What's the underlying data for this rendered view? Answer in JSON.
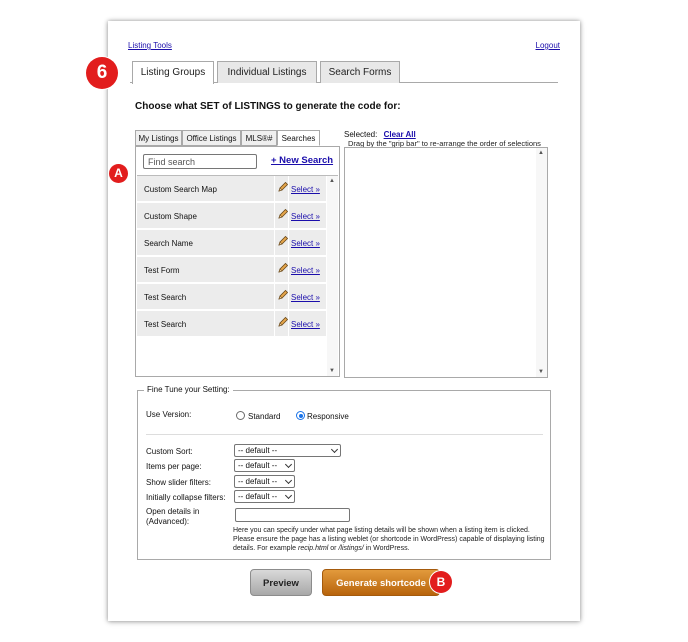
{
  "header": {
    "listing_tools": "Listing Tools",
    "logout": "Logout"
  },
  "tabs": [
    {
      "label": "Listing Groups",
      "active": true
    },
    {
      "label": "Individual Listings",
      "active": false
    },
    {
      "label": "Search Forms",
      "active": false
    }
  ],
  "badges": {
    "step": "6",
    "a": "A",
    "b": "B",
    "color": "#e21d1d"
  },
  "heading": "Choose what SET of LISTINGS to generate the code for:",
  "subtabs": [
    {
      "label": "My Listings",
      "active": false
    },
    {
      "label": "Office Listings",
      "active": false
    },
    {
      "label": "MLS®#",
      "active": false
    },
    {
      "label": "Searches",
      "active": true
    }
  ],
  "search": {
    "placeholder": "Find search",
    "new_search": "+ New Search"
  },
  "searches": [
    {
      "name": "Custom Search Map",
      "action": "Select »",
      "edit_icon": "pencil-icon"
    },
    {
      "name": "Custom Shape",
      "action": "Select »",
      "edit_icon": "pencil-icon"
    },
    {
      "name": "Search Name",
      "action": "Select »",
      "edit_icon": "pencil-icon"
    },
    {
      "name": "Test Form",
      "action": "Select »",
      "edit_icon": "pencil-icon"
    },
    {
      "name": "Test Search",
      "action": "Select »",
      "edit_icon": "pencil-icon"
    },
    {
      "name": "Test Search",
      "action": "Select »",
      "edit_icon": "pencil-icon"
    }
  ],
  "selected": {
    "label": "Selected:",
    "clear_all": "Clear All",
    "hint": "Drag by the \"grip bar\" to re-arrange the order of selections"
  },
  "fine_tune": {
    "legend": "Fine Tune your Setting:",
    "use_version_label": "Use Version:",
    "standard": "Standard",
    "responsive": "Responsive",
    "selected_version": "Responsive",
    "custom_sort_label": "Custom Sort:",
    "custom_sort_value": "-- default --",
    "items_per_page_label": "Items per page:",
    "items_per_page_value": "-- default --",
    "show_slider_label": "Show slider filters:",
    "show_slider_value": "-- default --",
    "collapse_label": "Initially collapse filters:",
    "collapse_value": "-- default --",
    "open_details_label": "Open details in (Advanced):",
    "open_details_value": "",
    "help_prefix": "Here you can specify under what page listing details will be shown when a listing item is clicked. Please ensure the page has a listing weblet (or shortcode in WordPress) capable of displaying listing details. For example ",
    "help_ex1": "recip.html",
    "help_mid": " or ",
    "help_ex2": "/listings/",
    "help_suffix": " in WordPress."
  },
  "buttons": {
    "preview": "Preview",
    "generate": "Generate shortcode"
  }
}
